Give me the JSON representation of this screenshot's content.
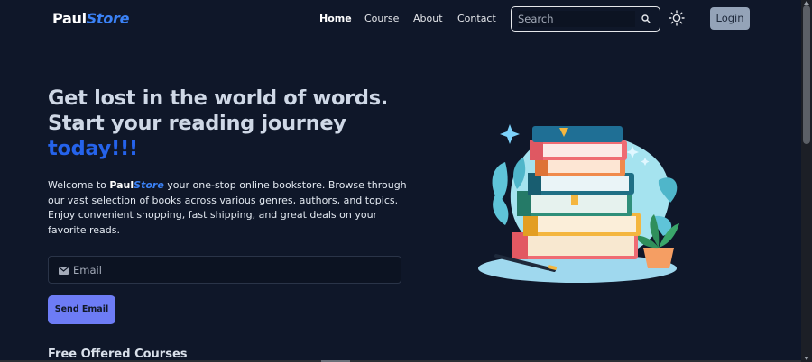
{
  "brand": {
    "part1": "Paul",
    "part2": "Store",
    "accent_color": "#3b82f6"
  },
  "nav": {
    "items": [
      {
        "label": "Home",
        "active": true
      },
      {
        "label": "Course",
        "active": false
      },
      {
        "label": "About",
        "active": false
      },
      {
        "label": "Contact",
        "active": false
      }
    ],
    "search_placeholder": "Search",
    "search_icon": "search-icon",
    "theme_icon": "sun-icon",
    "login_label": "Login"
  },
  "hero": {
    "headline_line1": "Get lost in the world of words.",
    "headline_line2": "Start your reading journey",
    "headline_highlight": "today!!!",
    "desc_before": "Welcome to ",
    "desc_brand1": "Paul",
    "desc_brand2": "Store",
    "desc_after": " your one-stop online bookstore. Browse through our vast selection of books across various genres, authors, and topics. Enjoy convenient shopping, fast shipping, and great deals on your favorite reads.",
    "email_placeholder": "Email",
    "email_icon": "mail-icon",
    "send_label": "Send Email",
    "illustration": "book-stack-illustration"
  },
  "section": {
    "title": "Free Offered Courses"
  },
  "colors": {
    "background": "#0f1729",
    "highlight": "#2563eb",
    "button": "#6d7cf5",
    "login": "#94a3b8"
  }
}
